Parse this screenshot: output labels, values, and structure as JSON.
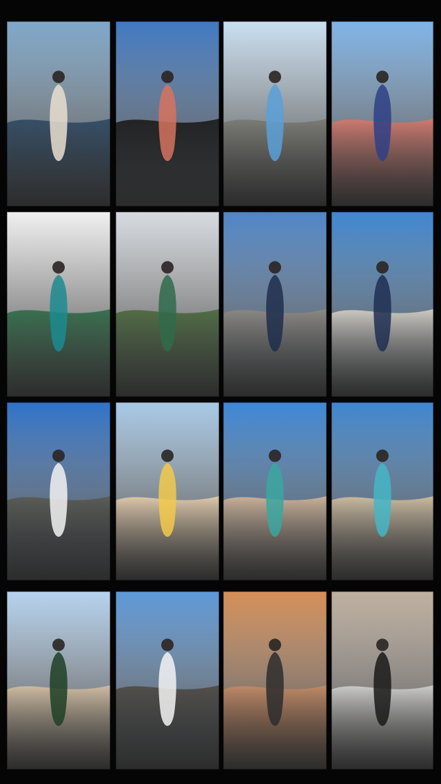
{
  "collage": {
    "background": "#050505",
    "tiles": [
      {
        "id": "beach-reflection",
        "sky": "#7fa7c9",
        "ground": "#2f4a63",
        "accent": "#e9dfcf"
      },
      {
        "id": "rock-island",
        "sky": "#3f78c2",
        "ground": "#1c1a18",
        "accent": "#d6735f"
      },
      {
        "id": "stone-statue",
        "sky": "#c9dff0",
        "ground": "#7b7a72",
        "accent": "#5aa0d8"
      },
      {
        "id": "city-street",
        "sky": "#7fb4e8",
        "ground": "#d97a6c",
        "accent": "#2f3f86"
      },
      {
        "id": "green-door",
        "sky": "#f0f0f0",
        "ground": "#2f6c48",
        "accent": "#1c8b8f"
      },
      {
        "id": "machu-picchu",
        "sky": "#d7dbe0",
        "ground": "#4a6a3d",
        "accent": "#2f6b4a"
      },
      {
        "id": "cliff-sea",
        "sky": "#4f86c8",
        "ground": "#8f8b84",
        "accent": "#1f2e4c"
      },
      {
        "id": "fortress-balcony",
        "sky": "#3f87d0",
        "ground": "#d8d2c8",
        "accent": "#1f2f52"
      },
      {
        "id": "eiffel-tower",
        "sky": "#2e72c8",
        "ground": "#5a5a50",
        "accent": "#f2f2f2"
      },
      {
        "id": "sunhat-beach",
        "sky": "#a8c9e6",
        "ground": "#e7cfae",
        "accent": "#f2c94c"
      },
      {
        "id": "group-beach",
        "sky": "#3d87d6",
        "ground": "#d5b79a",
        "accent": "#3aa7a0"
      },
      {
        "id": "turquoise-shore",
        "sky": "#3e86cf",
        "ground": "#d7c2a2",
        "accent": "#44b6c6"
      },
      {
        "id": "palm-beach",
        "sky": "#b6d3ee",
        "ground": "#d7c1a4",
        "accent": "#1f3f24"
      },
      {
        "id": "cruise-pier",
        "sky": "#5d98d8",
        "ground": "#4f4a44",
        "accent": "#f3f3f3"
      },
      {
        "id": "cactus-sunset",
        "sky": "#d58e57",
        "ground": "#c58c68",
        "accent": "#2d2d2d"
      },
      {
        "id": "brick-doorway",
        "sky": "#bfb0a0",
        "ground": "#d3d3d3",
        "accent": "#1a1a1a"
      }
    ]
  }
}
